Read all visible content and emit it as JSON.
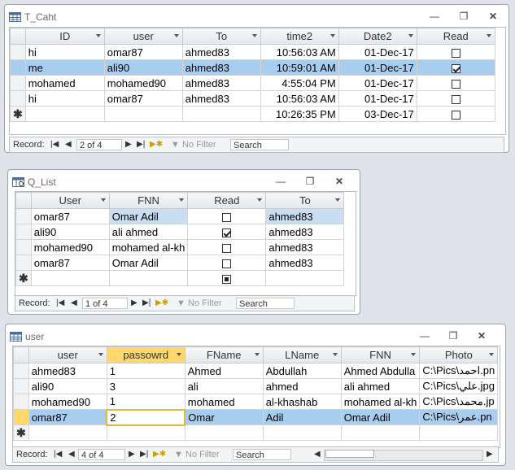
{
  "windows": {
    "t_caht": {
      "title": "T_Caht",
      "columns": [
        "ID",
        "user",
        "To",
        "time2",
        "Date2",
        "Read"
      ],
      "rows": [
        {
          "id": "hi",
          "user": "omar87",
          "to": "ahmed83",
          "time": "10:56:03 AM",
          "date": "01-Dec-17",
          "read": false
        },
        {
          "id": "me",
          "user": "ali90",
          "to": "ahmed83",
          "time": "10:59:01 AM",
          "date": "01-Dec-17",
          "read": true
        },
        {
          "id": "mohamed",
          "user": "mohamed90",
          "to": "ahmed83",
          "time": "4:55:04 PM",
          "date": "01-Dec-17",
          "read": false
        },
        {
          "id": "hi",
          "user": "omar87",
          "to": "ahmed83",
          "time": "10:56:03 AM",
          "date": "01-Dec-17",
          "read": false
        },
        {
          "id": "",
          "user": "",
          "to": "",
          "time": "10:26:35 PM",
          "date": "03-Dec-17",
          "read": false
        }
      ],
      "nav": {
        "record_label": "Record:",
        "position": "2 of 4",
        "filter": "No Filter",
        "search": "Search"
      }
    },
    "q_list": {
      "title": "Q_List",
      "columns": [
        "User",
        "FNN",
        "Read",
        "To"
      ],
      "rows": [
        {
          "user": "omar87",
          "fnn": "Omar Adil",
          "read": false,
          "to": "ahmed83"
        },
        {
          "user": "ali90",
          "fnn": "ali ahmed",
          "read": true,
          "to": "ahmed83"
        },
        {
          "user": "mohamed90",
          "fnn": "mohamed al-kh",
          "read": false,
          "to": "ahmed83"
        },
        {
          "user": "omar87",
          "fnn": "Omar Adil",
          "read": false,
          "to": "ahmed83"
        }
      ],
      "nav": {
        "record_label": "Record:",
        "position": "1 of 4",
        "filter": "No Filter",
        "search": "Search"
      }
    },
    "user": {
      "title": "user",
      "columns": [
        "user",
        "passowrd",
        "FName",
        "LName",
        "FNN",
        "Photo"
      ],
      "rows": [
        {
          "user": "ahmed83",
          "pw": "1",
          "fname": "Ahmed",
          "lname": "Abdullah",
          "fnn": "Ahmed Abdulla",
          "photo": "C:\\Pics\\احمد.pn"
        },
        {
          "user": "ali90",
          "pw": "3",
          "fname": "ali",
          "lname": "ahmed",
          "fnn": "ali ahmed",
          "photo": "C:\\Pics\\علي.jpg"
        },
        {
          "user": "mohamed90",
          "pw": "1",
          "fname": "mohamed",
          "lname": "al-khashab",
          "fnn": "mohamed al-kh",
          "photo": "C:\\Pics\\محمد.jp"
        },
        {
          "user": "omar87",
          "pw": "2",
          "fname": "Omar",
          "lname": "Adil",
          "fnn": "Omar Adil",
          "photo": "C:\\Pics\\عمر.pn"
        }
      ],
      "nav": {
        "record_label": "Record:",
        "position": "4 of 4",
        "filter": "No Filter",
        "search": "Search"
      }
    }
  },
  "icons": {
    "minimize": "minimize-icon",
    "maximize": "maximize-icon",
    "close": "close-icon",
    "table": "table-icon",
    "query": "query-icon"
  },
  "colors": {
    "selected_row": "#a9cdee",
    "selected_column_header": "#ffd76a"
  }
}
